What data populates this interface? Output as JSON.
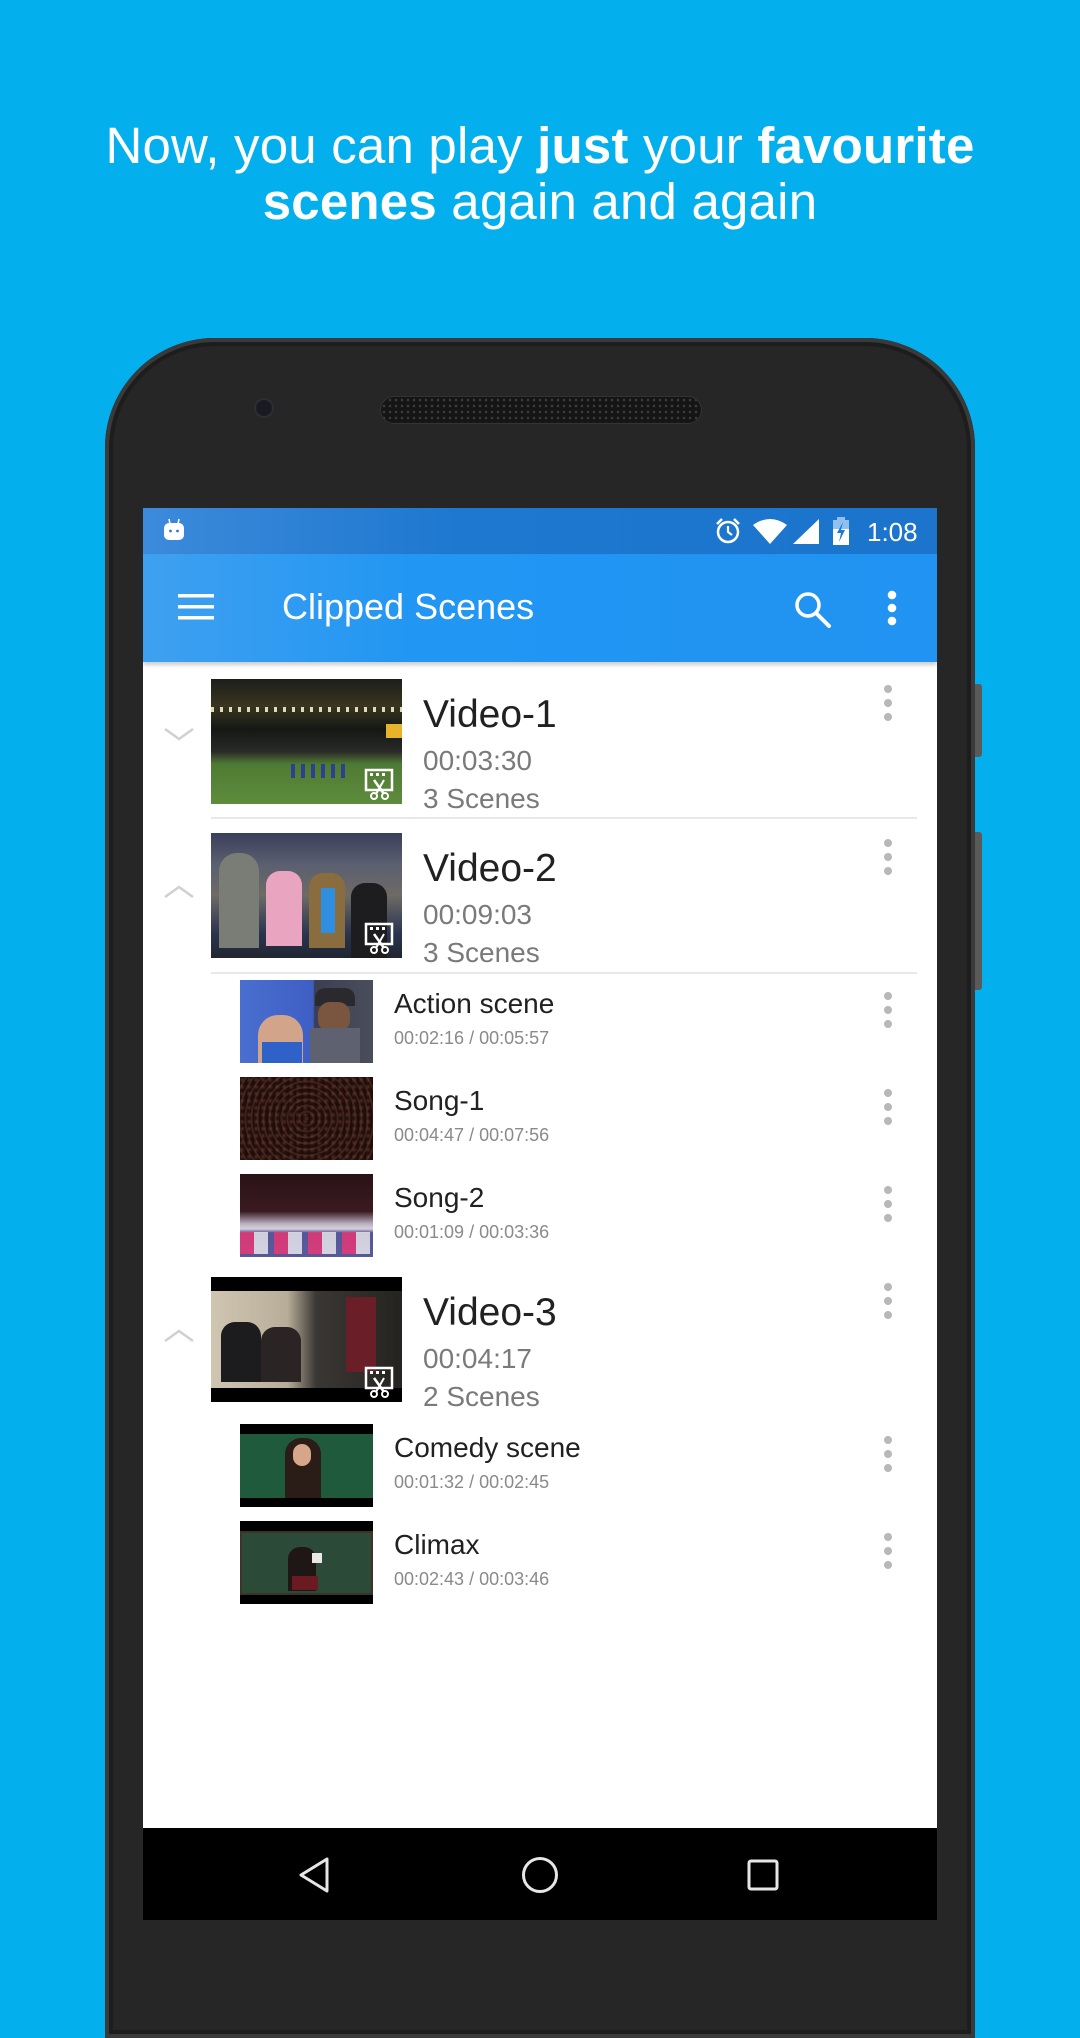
{
  "headline": {
    "line1_parts": [
      {
        "text": "Now, you can play ",
        "bold": false
      },
      {
        "text": "just",
        "bold": true
      },
      {
        "text": " your ",
        "bold": false
      },
      {
        "text": "favourite",
        "bold": true
      }
    ],
    "line2_parts": [
      {
        "text": "scenes",
        "bold": true
      },
      {
        "text": " again and again",
        "bold": false
      }
    ]
  },
  "colors": {
    "background": "#03AFEC",
    "toolbar": "#2196F3",
    "status_bar": "#1E78CF"
  },
  "status_bar": {
    "left_icons": [
      "android-notification-icon"
    ],
    "right_icons": [
      "alarm-icon",
      "wifi-icon",
      "signal-icon",
      "battery-charging-icon"
    ],
    "time": "1:08"
  },
  "toolbar": {
    "menu_icon": "hamburger-menu-icon",
    "title": "Clipped Scenes",
    "search_icon": "search-icon",
    "overflow_icon": "more-vert-icon"
  },
  "videos": [
    {
      "name": "Video-1",
      "duration": "00:03:30",
      "scenes_label": "3 Scenes",
      "expanded": false,
      "scenes": []
    },
    {
      "name": "Video-2",
      "duration": "00:09:03",
      "scenes_label": "3 Scenes",
      "expanded": true,
      "scenes": [
        {
          "name": "Action scene",
          "time": "00:02:16 / 00:05:57"
        },
        {
          "name": "Song-1",
          "time": "00:04:47 / 00:07:56"
        },
        {
          "name": "Song-2",
          "time": "00:01:09 / 00:03:36"
        }
      ]
    },
    {
      "name": "Video-3",
      "duration": "00:04:17",
      "scenes_label": "2 Scenes",
      "expanded": true,
      "scenes": [
        {
          "name": "Comedy scene",
          "time": "00:01:32 / 00:02:45"
        },
        {
          "name": "Climax",
          "time": "00:02:43 / 00:03:46"
        }
      ]
    }
  ],
  "nav_bar": {
    "back_icon": "back-icon",
    "home_icon": "home-icon",
    "recents_icon": "recents-icon"
  }
}
